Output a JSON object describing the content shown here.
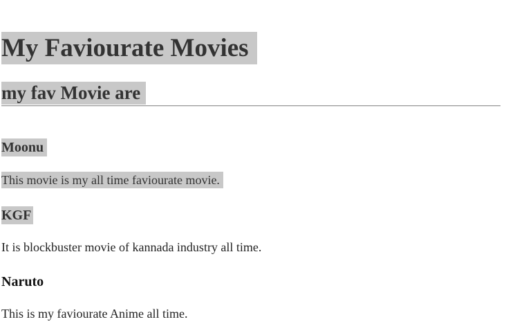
{
  "page": {
    "title": "My Faviourate Movies",
    "subtitle": "my fav Movie are"
  },
  "movies": [
    {
      "name": "Moonu",
      "description": "This movie is my all time faviourate movie."
    },
    {
      "name": "KGF",
      "description": "It is blockbuster movie of kannada industry all time."
    },
    {
      "name": "Naruto",
      "description": "This is my faviourate Anime all time."
    }
  ],
  "colors": {
    "highlight": "#c8c8c8",
    "text": "#333333",
    "divider": "#9a9a9a"
  }
}
